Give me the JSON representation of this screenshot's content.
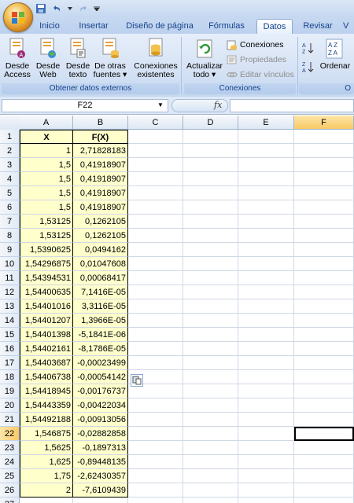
{
  "quick_access": {
    "icons": [
      "save-icon",
      "undo-icon",
      "redo-icon"
    ]
  },
  "tabs": [
    {
      "label": "Inicio",
      "active": false
    },
    {
      "label": "Insertar",
      "active": false
    },
    {
      "label": "Diseño de página",
      "active": false
    },
    {
      "label": "Fórmulas",
      "active": false
    },
    {
      "label": "Datos",
      "active": true
    },
    {
      "label": "Revisar",
      "active": false
    },
    {
      "label": "V",
      "active": false
    }
  ],
  "ribbon": {
    "group_external": {
      "label": "Obtener datos externos",
      "buttons": [
        {
          "line1": "Desde",
          "line2": "Access",
          "icon": "access-icon"
        },
        {
          "line1": "Desde",
          "line2": "Web",
          "icon": "web-icon"
        },
        {
          "line1": "Desde",
          "line2": "texto",
          "icon": "text-file-icon"
        },
        {
          "line1": "De otras",
          "line2": "fuentes ▾",
          "icon": "other-sources-icon"
        },
        {
          "line1": "Conexiones",
          "line2": "existentes",
          "icon": "existing-connections-icon"
        }
      ]
    },
    "group_connections": {
      "label": "Conexiones",
      "refresh": {
        "line1": "Actualizar",
        "line2": "todo ▾"
      },
      "connections": "Conexiones",
      "properties": "Propiedades",
      "edit_links": "Editar vínculos"
    },
    "group_sort": {
      "sort_label": "Ordenar",
      "group_label": "O"
    }
  },
  "formula_bar": {
    "name_box": "F22",
    "fx_label": "fx",
    "formula": ""
  },
  "sheet": {
    "columns": [
      "A",
      "B",
      "C",
      "D",
      "E",
      "F"
    ],
    "active_column": "F",
    "active_row": 22,
    "header_row": {
      "A": "X",
      "B": "F(X)"
    },
    "rows": [
      {
        "row": 2,
        "A": "1",
        "B": "2,71828183"
      },
      {
        "row": 3,
        "A": "1,5",
        "B": "0,41918907"
      },
      {
        "row": 4,
        "A": "1,5",
        "B": "0,41918907"
      },
      {
        "row": 5,
        "A": "1,5",
        "B": "0,41918907"
      },
      {
        "row": 6,
        "A": "1,5",
        "B": "0,41918907"
      },
      {
        "row": 7,
        "A": "1,53125",
        "B": "0,1262105"
      },
      {
        "row": 8,
        "A": "1,53125",
        "B": "0,1262105"
      },
      {
        "row": 9,
        "A": "1,5390625",
        "B": "0,0494162"
      },
      {
        "row": 10,
        "A": "1,54296875",
        "B": "0,01047608"
      },
      {
        "row": 11,
        "A": "1,54394531",
        "B": "0,00068417"
      },
      {
        "row": 12,
        "A": "1,54400635",
        "B": "7,1416E-05"
      },
      {
        "row": 13,
        "A": "1,54401016",
        "B": "3,3116E-05"
      },
      {
        "row": 14,
        "A": "1,54401207",
        "B": "1,3966E-05"
      },
      {
        "row": 15,
        "A": "1,54401398",
        "B": "-5,1841E-06"
      },
      {
        "row": 16,
        "A": "1,54402161",
        "B": "-8,1786E-05"
      },
      {
        "row": 17,
        "A": "1,54403687",
        "B": "-0,00023499"
      },
      {
        "row": 18,
        "A": "1,54406738",
        "B": "-0,00054142"
      },
      {
        "row": 19,
        "A": "1,54418945",
        "B": "-0,00176737"
      },
      {
        "row": 20,
        "A": "1,54443359",
        "B": "-0,00422034"
      },
      {
        "row": 21,
        "A": "1,54492188",
        "B": "-0,00913056"
      },
      {
        "row": 22,
        "A": "1,546875",
        "B": "-0,02882858"
      },
      {
        "row": 23,
        "A": "1,5625",
        "B": "-0,1897313"
      },
      {
        "row": 24,
        "A": "1,625",
        "B": "-0,89448135"
      },
      {
        "row": 25,
        "A": "1,75",
        "B": "-2,62430357"
      },
      {
        "row": 26,
        "A": "2",
        "B": "-7,6109439"
      },
      {
        "row": 27,
        "A": "",
        "B": ""
      }
    ]
  },
  "colors": {
    "cell_fill": "#ffffcc",
    "header_active": "#f9c965",
    "ribbon_text": "#15428b"
  }
}
